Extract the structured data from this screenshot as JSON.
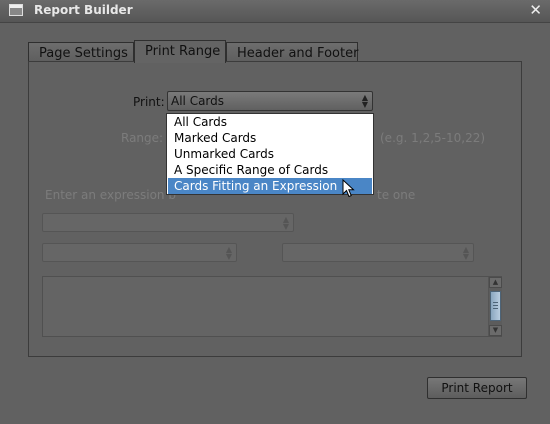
{
  "window": {
    "title": "Report Builder"
  },
  "tabs": [
    {
      "label": "Page Settings"
    },
    {
      "label": "Print Range"
    },
    {
      "label": "Header and Footer"
    }
  ],
  "print_range": {
    "print_label": "Print:",
    "print_value": "All Cards",
    "range_label": "Range:",
    "range_hint": "(e.g. 1,2,5-10,22)",
    "expression_hint_start": "Enter an expression b",
    "expression_hint_end": "te one"
  },
  "dropdown": {
    "options": [
      "All Cards",
      "Marked Cards",
      "Unmarked Cards",
      "A Specific Range of Cards",
      "Cards Fitting an Expression"
    ],
    "highlighted": "Cards Fitting an Expression"
  },
  "buttons": {
    "print_report": "Print Report"
  },
  "colors": {
    "highlight": "#4a86c6",
    "window_bg": "#616161"
  },
  "icons": {
    "close": "close-icon",
    "spinner": "spinner-arrows-icon",
    "cursor": "mouse-pointer-icon"
  }
}
